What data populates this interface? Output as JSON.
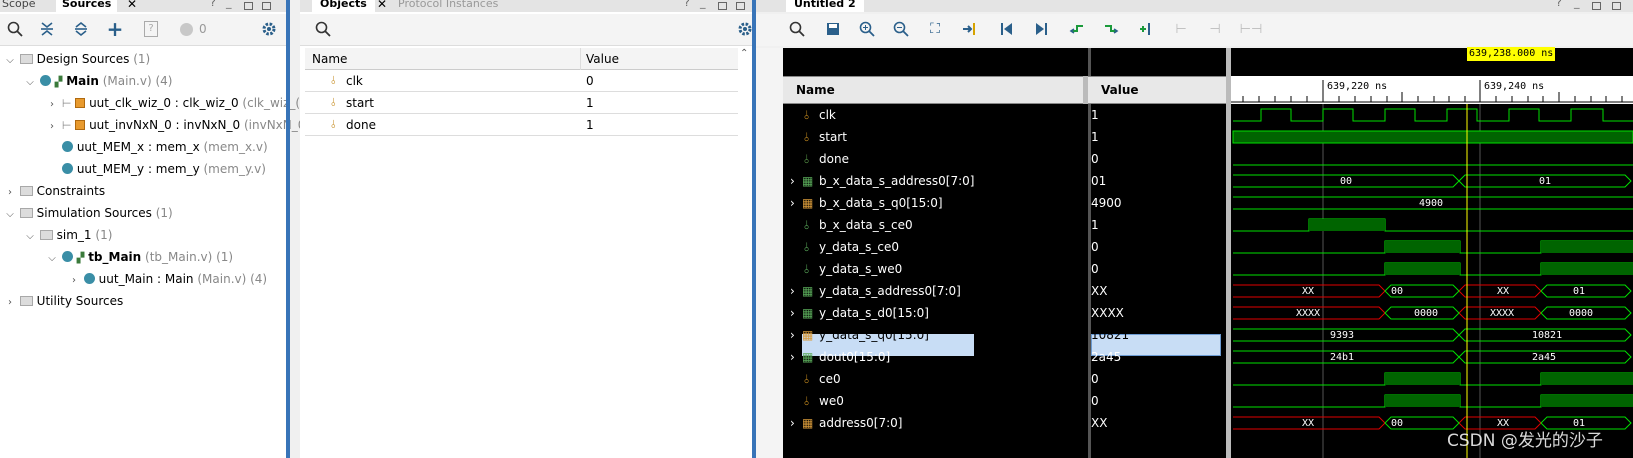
{
  "left_panel": {
    "tabs": [
      "Scope",
      "Sources"
    ],
    "toolbar_badge": "0",
    "tree": [
      {
        "label": "Design Sources",
        "suffix": "(1)"
      },
      {
        "label": "Main",
        "suffix": "(Main.v) (4)"
      },
      {
        "label": "uut_clk_wiz_0 : clk_wiz_0",
        "suffix": "(clk_wiz_("
      },
      {
        "label": "uut_invNxN_0 : invNxN_0",
        "suffix": "(invNxN_0"
      },
      {
        "label": "uut_MEM_x : mem_x",
        "suffix": "(mem_x.v)"
      },
      {
        "label": "uut_MEM_y : mem_y",
        "suffix": "(mem_y.v)"
      },
      {
        "label": "Constraints",
        "suffix": ""
      },
      {
        "label": "Simulation Sources",
        "suffix": "(1)"
      },
      {
        "label": "sim_1",
        "suffix": "(1)"
      },
      {
        "label": "tb_Main",
        "suffix": "(tb_Main.v) (1)"
      },
      {
        "label": "uut_Main : Main",
        "suffix": "(Main.v) (4)"
      },
      {
        "label": "Utility Sources",
        "suffix": ""
      }
    ]
  },
  "objects_panel": {
    "tabs": [
      "Objects",
      "Protocol Instances"
    ],
    "col_name": "Name",
    "col_value": "Value",
    "rows": [
      {
        "name": "clk",
        "value": "0"
      },
      {
        "name": "start",
        "value": "1"
      },
      {
        "name": "done",
        "value": "1"
      }
    ]
  },
  "wave_panel": {
    "tab": "Untitled 2",
    "cursor_time": "639,238.000 ns",
    "time_labels": [
      "639,220 ns",
      "639,240 ns"
    ],
    "col_name": "Name",
    "col_value": "Value",
    "watermark": "CSDN @发光的沙子",
    "signals": [
      {
        "name": "clk",
        "value": "1"
      },
      {
        "name": "start",
        "value": "1"
      },
      {
        "name": "done",
        "value": "0"
      },
      {
        "name": "b_x_data_s_address0[7:0]",
        "value": "01"
      },
      {
        "name": "b_x_data_s_q0[15:0]",
        "value": "4900"
      },
      {
        "name": "b_x_data_s_ce0",
        "value": "1"
      },
      {
        "name": "y_data_s_ce0",
        "value": "0"
      },
      {
        "name": "y_data_s_we0",
        "value": "0"
      },
      {
        "name": "y_data_s_address0[7:0]",
        "value": "XX"
      },
      {
        "name": "y_data_s_d0[15:0]",
        "value": "XXXX"
      },
      {
        "name": "y_data_s_q0[15:0]",
        "value": "10821"
      },
      {
        "name": "dout0[15:0]",
        "value": "2a45"
      },
      {
        "name": "ce0",
        "value": "0"
      },
      {
        "name": "we0",
        "value": "0"
      },
      {
        "name": "address0[7:0]",
        "value": "XX"
      }
    ],
    "bus_labels": {
      "b_x_addr": [
        "00",
        "01"
      ],
      "b_x_q0": [
        "4900"
      ],
      "y_addr": [
        "XX",
        "00",
        "XX",
        "01"
      ],
      "y_d0": [
        "XXXX",
        "0000",
        "XXXX",
        "0000"
      ],
      "y_q0": [
        "9393",
        "10821"
      ],
      "dout0": [
        "24b1",
        "2a45"
      ],
      "addr0": [
        "XX",
        "00",
        "XX",
        "01"
      ]
    }
  }
}
